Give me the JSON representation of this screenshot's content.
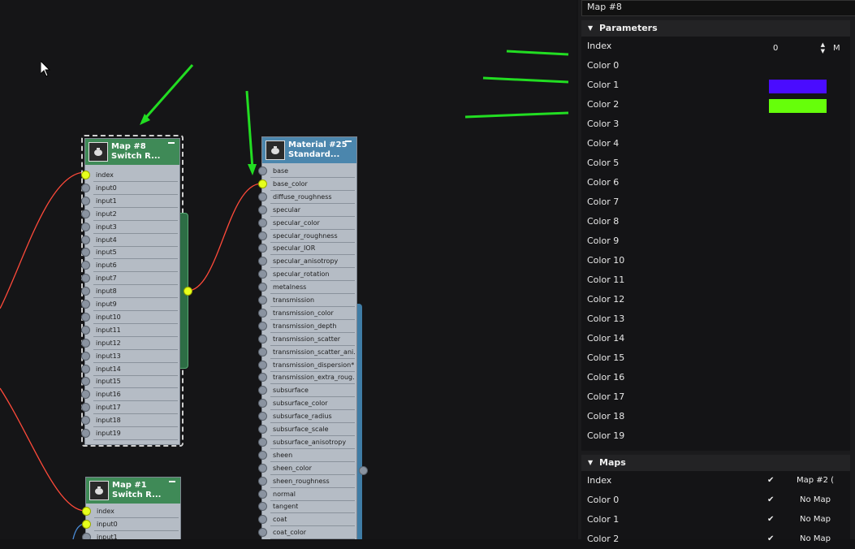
{
  "panel": {
    "map_name": "Map #8",
    "parameters_title": "Parameters",
    "index_label": "Index",
    "index_value": "0",
    "m_label": "M",
    "color_labels": [
      "Color 0",
      "Color 1",
      "Color 2",
      "Color 3",
      "Color 4",
      "Color 5",
      "Color 6",
      "Color 7",
      "Color 8",
      "Color 9",
      "Color 10",
      "Color 11",
      "Color 12",
      "Color 13",
      "Color 14",
      "Color 15",
      "Color 16",
      "Color 17",
      "Color 18",
      "Color 19"
    ],
    "swatch_colors": {
      "color1": "#4a0cff",
      "color2": "#66ff0a"
    },
    "maps_title": "Maps",
    "maps_rows": [
      {
        "label": "Index",
        "check": "✔",
        "value": "Map #2 ("
      },
      {
        "label": "Color 0",
        "check": "✔",
        "value": "No Map"
      },
      {
        "label": "Color 1",
        "check": "✔",
        "value": "No Map"
      },
      {
        "label": "Color 2",
        "check": "✔",
        "value": "No Map"
      }
    ]
  },
  "nodes": {
    "map8": {
      "title_line1": "Map #8",
      "title_line2": "Switch R...",
      "ports": [
        "index",
        "input0",
        "input1",
        "input2",
        "input3",
        "input4",
        "input5",
        "input6",
        "input7",
        "input8",
        "input9",
        "input10",
        "input11",
        "input12",
        "input13",
        "input14",
        "input15",
        "input16",
        "input17",
        "input18",
        "input19"
      ]
    },
    "mat25": {
      "title_line1": "Material #25",
      "title_line2": "Standard...",
      "ports": [
        "base",
        "base_color",
        "diffuse_roughness",
        "specular",
        "specular_color",
        "specular_roughness",
        "specular_IOR",
        "specular_anisotropy",
        "specular_rotation",
        "metalness",
        "transmission",
        "transmission_color",
        "transmission_depth",
        "transmission_scatter",
        "transmission_scatter_ani...",
        "transmission_dispersion*",
        "transmission_extra_roug...",
        "subsurface",
        "subsurface_color",
        "subsurface_radius",
        "subsurface_scale",
        "subsurface_anisotropy",
        "sheen",
        "sheen_color",
        "sheen_roughness",
        "normal",
        "tangent",
        "coat",
        "coat_color"
      ]
    },
    "map1": {
      "title_line1": "Map #1",
      "title_line2": "Switch R...",
      "ports": [
        "index",
        "input0",
        "input1"
      ]
    }
  },
  "colors": {
    "accent_green": "#22dd22",
    "wire": "#ff4a3a",
    "switch_header": "#3f8a57",
    "material_header": "#4b86ad",
    "socket_active": "#e6ff1c"
  }
}
